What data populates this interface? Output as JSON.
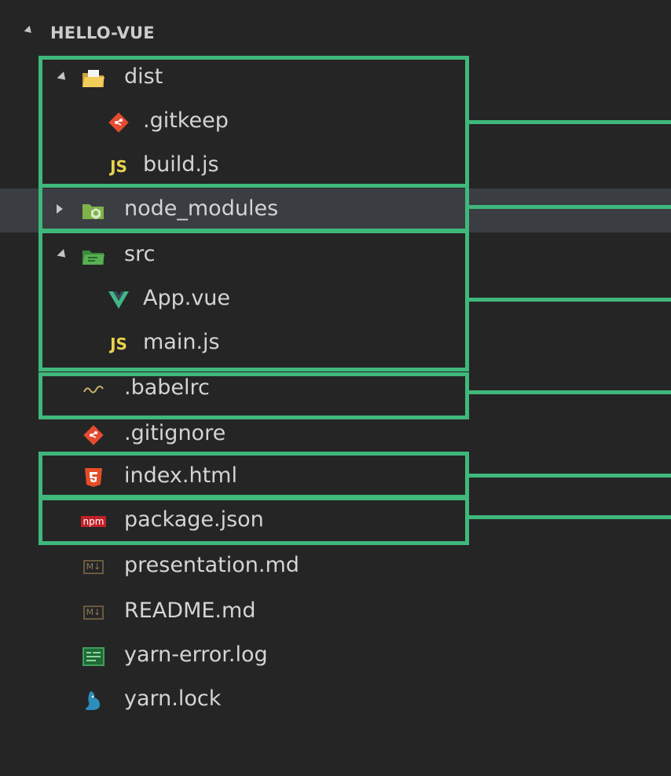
{
  "explorer": {
    "title": "HELLO-VUE",
    "items": [
      {
        "label": "dist",
        "icon": "folder-dist-open-icon"
      },
      {
        "label": ".gitkeep",
        "icon": "git-icon"
      },
      {
        "label": "build.js",
        "icon": "js-icon",
        "icon_text": "JS"
      },
      {
        "label": "node_modules",
        "icon": "folder-node-icon"
      },
      {
        "label": "src",
        "icon": "folder-src-open-icon"
      },
      {
        "label": "App.vue",
        "icon": "vue-icon"
      },
      {
        "label": "main.js",
        "icon": "js-icon",
        "icon_text": "JS"
      },
      {
        "label": ".babelrc",
        "icon": "babel-icon",
        "icon_text": "Babel"
      },
      {
        "label": ".gitignore",
        "icon": "git-icon"
      },
      {
        "label": "index.html",
        "icon": "html5-icon"
      },
      {
        "label": "package.json",
        "icon": "npm-icon",
        "icon_text": "npm"
      },
      {
        "label": "presentation.md",
        "icon": "markdown-icon",
        "icon_text": "M↓"
      },
      {
        "label": "README.md",
        "icon": "markdown-icon",
        "icon_text": "M↓"
      },
      {
        "label": "yarn-error.log",
        "icon": "log-icon"
      },
      {
        "label": "yarn.lock",
        "icon": "yarn-icon"
      }
    ]
  },
  "colors": {
    "background": "#252526",
    "selected_row": "#3a3d41",
    "highlight": "#3fb87b",
    "text": "#d4d4d4"
  }
}
